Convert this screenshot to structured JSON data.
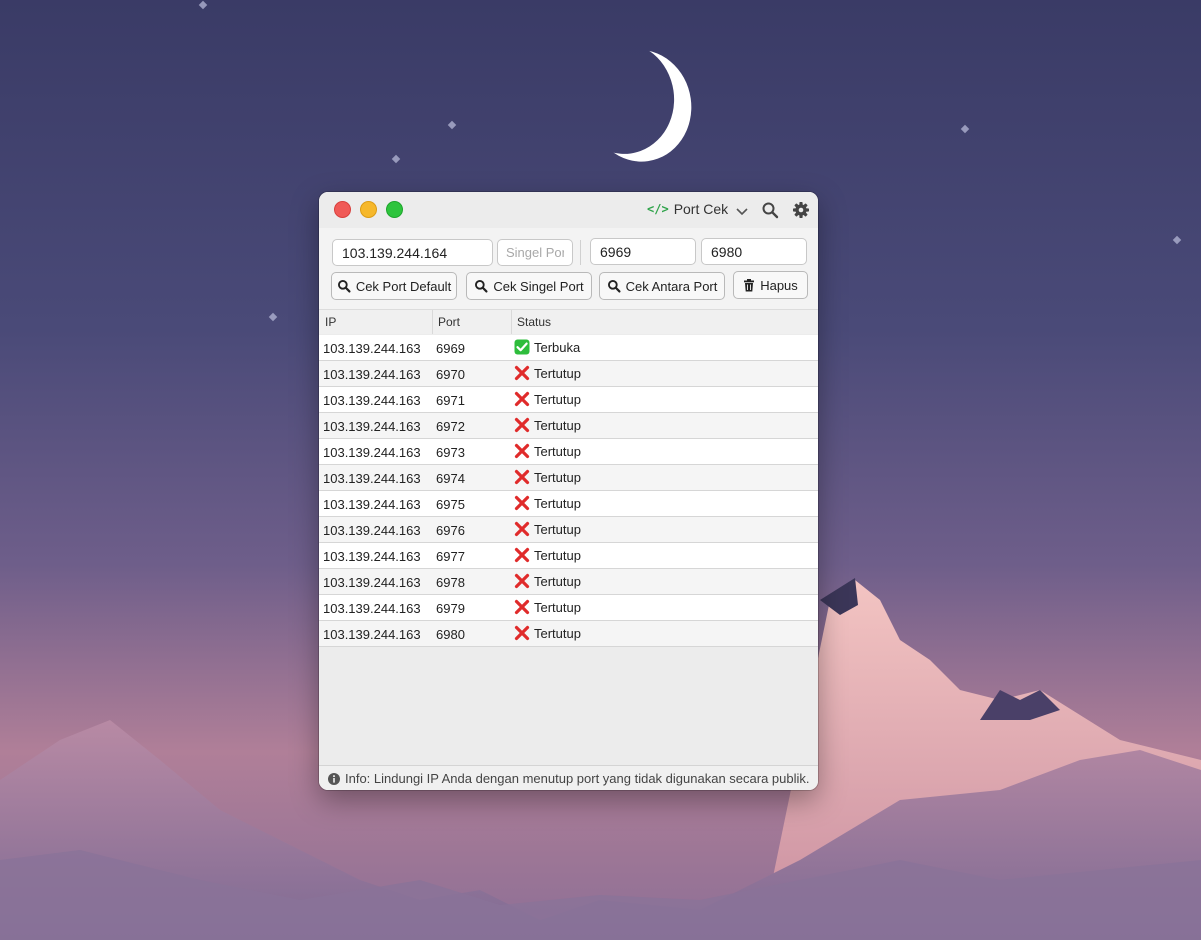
{
  "window": {
    "app_title": "Port Cek",
    "title_icon": "code-icon"
  },
  "inputs": {
    "ip_value": "103.139.244.164",
    "single_port_placeholder": "Singel Port",
    "single_port_value": "",
    "range_from_value": "6969",
    "range_to_value": "6980"
  },
  "buttons": {
    "default_label": "Cek Port Default",
    "single_label": "Cek Singel Port",
    "range_label": "Cek Antara Port",
    "clear_label": "Hapus"
  },
  "table": {
    "columns": [
      "IP",
      "Port",
      "Status"
    ],
    "rows": [
      {
        "ip": "103.139.244.163",
        "port": "6969",
        "status": "Terbuka",
        "open": true
      },
      {
        "ip": "103.139.244.163",
        "port": "6970",
        "status": "Tertutup",
        "open": false
      },
      {
        "ip": "103.139.244.163",
        "port": "6971",
        "status": "Tertutup",
        "open": false
      },
      {
        "ip": "103.139.244.163",
        "port": "6972",
        "status": "Tertutup",
        "open": false
      },
      {
        "ip": "103.139.244.163",
        "port": "6973",
        "status": "Tertutup",
        "open": false
      },
      {
        "ip": "103.139.244.163",
        "port": "6974",
        "status": "Tertutup",
        "open": false
      },
      {
        "ip": "103.139.244.163",
        "port": "6975",
        "status": "Tertutup",
        "open": false
      },
      {
        "ip": "103.139.244.163",
        "port": "6976",
        "status": "Tertutup",
        "open": false
      },
      {
        "ip": "103.139.244.163",
        "port": "6977",
        "status": "Tertutup",
        "open": false
      },
      {
        "ip": "103.139.244.163",
        "port": "6978",
        "status": "Tertutup",
        "open": false
      },
      {
        "ip": "103.139.244.163",
        "port": "6979",
        "status": "Tertutup",
        "open": false
      },
      {
        "ip": "103.139.244.163",
        "port": "6980",
        "status": "Tertutup",
        "open": false
      }
    ]
  },
  "statusbar": {
    "info_text": "Info: Lindungi IP Anda dengan menutup port yang tidak digunakan secara publik."
  },
  "colors": {
    "open_green": "#2ebd3c",
    "closed_red": "#e02b2b",
    "close_light": "#f05a57",
    "minimize_light": "#f6b82b",
    "zoom_light": "#2ec43d"
  }
}
